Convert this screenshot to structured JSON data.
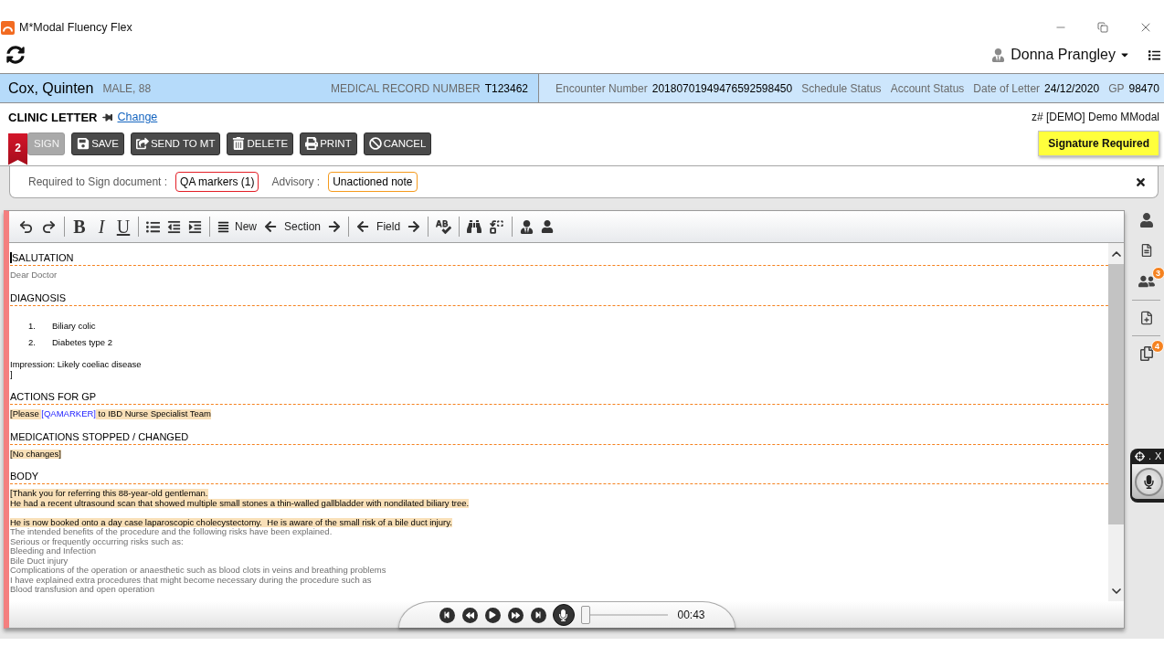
{
  "window": {
    "title": "M*Modal Fluency Flex"
  },
  "user": {
    "name": "Donna Prangley"
  },
  "patient": {
    "name": "Cox, Quinten",
    "details": "MALE, 88",
    "record": {
      "label": "MEDICAL RECORD NUMBER",
      "value": "T123462"
    },
    "fields": [
      {
        "label": "Encounter Number",
        "value": "20180701949476592598450"
      },
      {
        "label": "Schedule Status"
      },
      {
        "label": "Account Status"
      },
      {
        "label": "Date of Letter",
        "value": "24/12/2020"
      },
      {
        "label": "GP",
        "value": "98470"
      }
    ]
  },
  "letter": {
    "title": "CLINIC LETTER",
    "change_link": "Change",
    "organization": "z# [DEMO] Demo MModal",
    "status": "Signature Required"
  },
  "actions": [
    {
      "kind": "sign",
      "label": "SIGN",
      "disabled": true,
      "badge": "2"
    },
    {
      "kind": "save",
      "label": "SAVE",
      "disabled": false
    },
    {
      "kind": "send",
      "label": "SEND TO MT",
      "disabled": false
    },
    {
      "kind": "delete",
      "label": "DELETE",
      "disabled": false
    },
    {
      "kind": "print",
      "label": "PRINT",
      "disabled": false
    },
    {
      "kind": "cancel",
      "label": "CANCEL",
      "disabled": false
    }
  ],
  "requirements": {
    "required_label": "Required to Sign document :",
    "required": [
      "QA markers (1)"
    ],
    "advisory_label": "Advisory :",
    "advisory": [
      "Unactioned note"
    ]
  },
  "toolbar": [
    {
      "kind": "undo"
    },
    {
      "kind": "redo"
    },
    {
      "kind": "separator"
    },
    {
      "kind": "bold",
      "label": "B"
    },
    {
      "kind": "italic",
      "label": "I"
    },
    {
      "kind": "underline",
      "label": "U"
    },
    {
      "kind": "separator"
    },
    {
      "kind": "bullets"
    },
    {
      "kind": "outdent"
    },
    {
      "kind": "indent"
    },
    {
      "kind": "separator"
    },
    {
      "kind": "new",
      "label": "New"
    },
    {
      "kind": "navigator",
      "label": "Section"
    },
    {
      "kind": "separator"
    },
    {
      "kind": "navigator",
      "label": "Field"
    },
    {
      "kind": "separator"
    },
    {
      "kind": "spellcheck"
    },
    {
      "kind": "separator"
    },
    {
      "kind": "find"
    },
    {
      "kind": "replace"
    },
    {
      "kind": "separator"
    },
    {
      "kind": "author"
    },
    {
      "kind": "patient"
    }
  ],
  "document": {
    "sections": [
      {
        "heading": "SALUTATION",
        "cursor": true,
        "lines": [
          {
            "kind": "template",
            "text": "Dear Doctor"
          }
        ]
      },
      {
        "heading": "DIAGNOSIS",
        "cursor": false,
        "lines": [
          {
            "kind": "list",
            "items": [
              {
                "number": "1.",
                "text": "Biliary colic"
              },
              {
                "number": "2.",
                "text": "Diabetes type 2"
              }
            ]
          },
          {
            "kind": "text",
            "text": "Impression: Likely coeliac disease",
            "space_before": true
          },
          {
            "kind": "text",
            "text": "]"
          }
        ]
      },
      {
        "heading": "ACTIONS FOR GP",
        "cursor": false,
        "lines": [
          {
            "kind": "mixed",
            "segments": [
              {
                "kind": "field",
                "text": "[Please "
              },
              {
                "kind": "marker",
                "text": "[QAMARKER]"
              },
              {
                "kind": "field",
                "text": " to IBD Nurse Specialist Team"
              }
            ]
          }
        ]
      },
      {
        "heading": "MEDICATIONS STOPPED / CHANGED",
        "cursor": false,
        "lines": [
          {
            "kind": "field",
            "text": "[No changes]"
          }
        ]
      },
      {
        "heading": "BODY",
        "cursor": false,
        "lines": [
          {
            "kind": "field",
            "text": "[Thank you for referring this 88-year-old gentleman."
          },
          {
            "kind": "field",
            "text": "He had a recent ultrasound scan that showed multiple small stones a thin-walled gallbladder with nondilated biliary tree."
          },
          {
            "kind": "field",
            "text": "He is now booked onto a day case laparoscopic cholecystectomy.  He is aware of the small risk of a bile duct injury.",
            "space_before": true
          },
          {
            "kind": "template",
            "text": "The intended benefits of the procedure and the following risks have been explained."
          },
          {
            "kind": "template",
            "text": "Serious or frequently occurring risks such as:"
          },
          {
            "kind": "template",
            "text": "Bleeding and Infection"
          },
          {
            "kind": "template",
            "text": "Bile Duct injury"
          },
          {
            "kind": "template",
            "text": "Complications of the operation or anaesthetic such as blood clots in veins and breathing problems"
          },
          {
            "kind": "template",
            "text": "I have explained extra procedures that might become necessary during the procedure such as"
          },
          {
            "kind": "template",
            "text": "Blood transfusion and open operation"
          }
        ]
      }
    ]
  },
  "player": {
    "time": "00:43",
    "level": 0
  },
  "sidebar": {
    "groups": [
      [
        {
          "kind": "person"
        },
        {
          "kind": "document"
        },
        {
          "kind": "people",
          "badge": "3"
        }
      ],
      [
        {
          "kind": "add_note"
        }
      ],
      [
        {
          "kind": "copies",
          "badge": "4"
        }
      ]
    ]
  },
  "mic_widget": {
    "minimize": ".",
    "close": "X"
  }
}
